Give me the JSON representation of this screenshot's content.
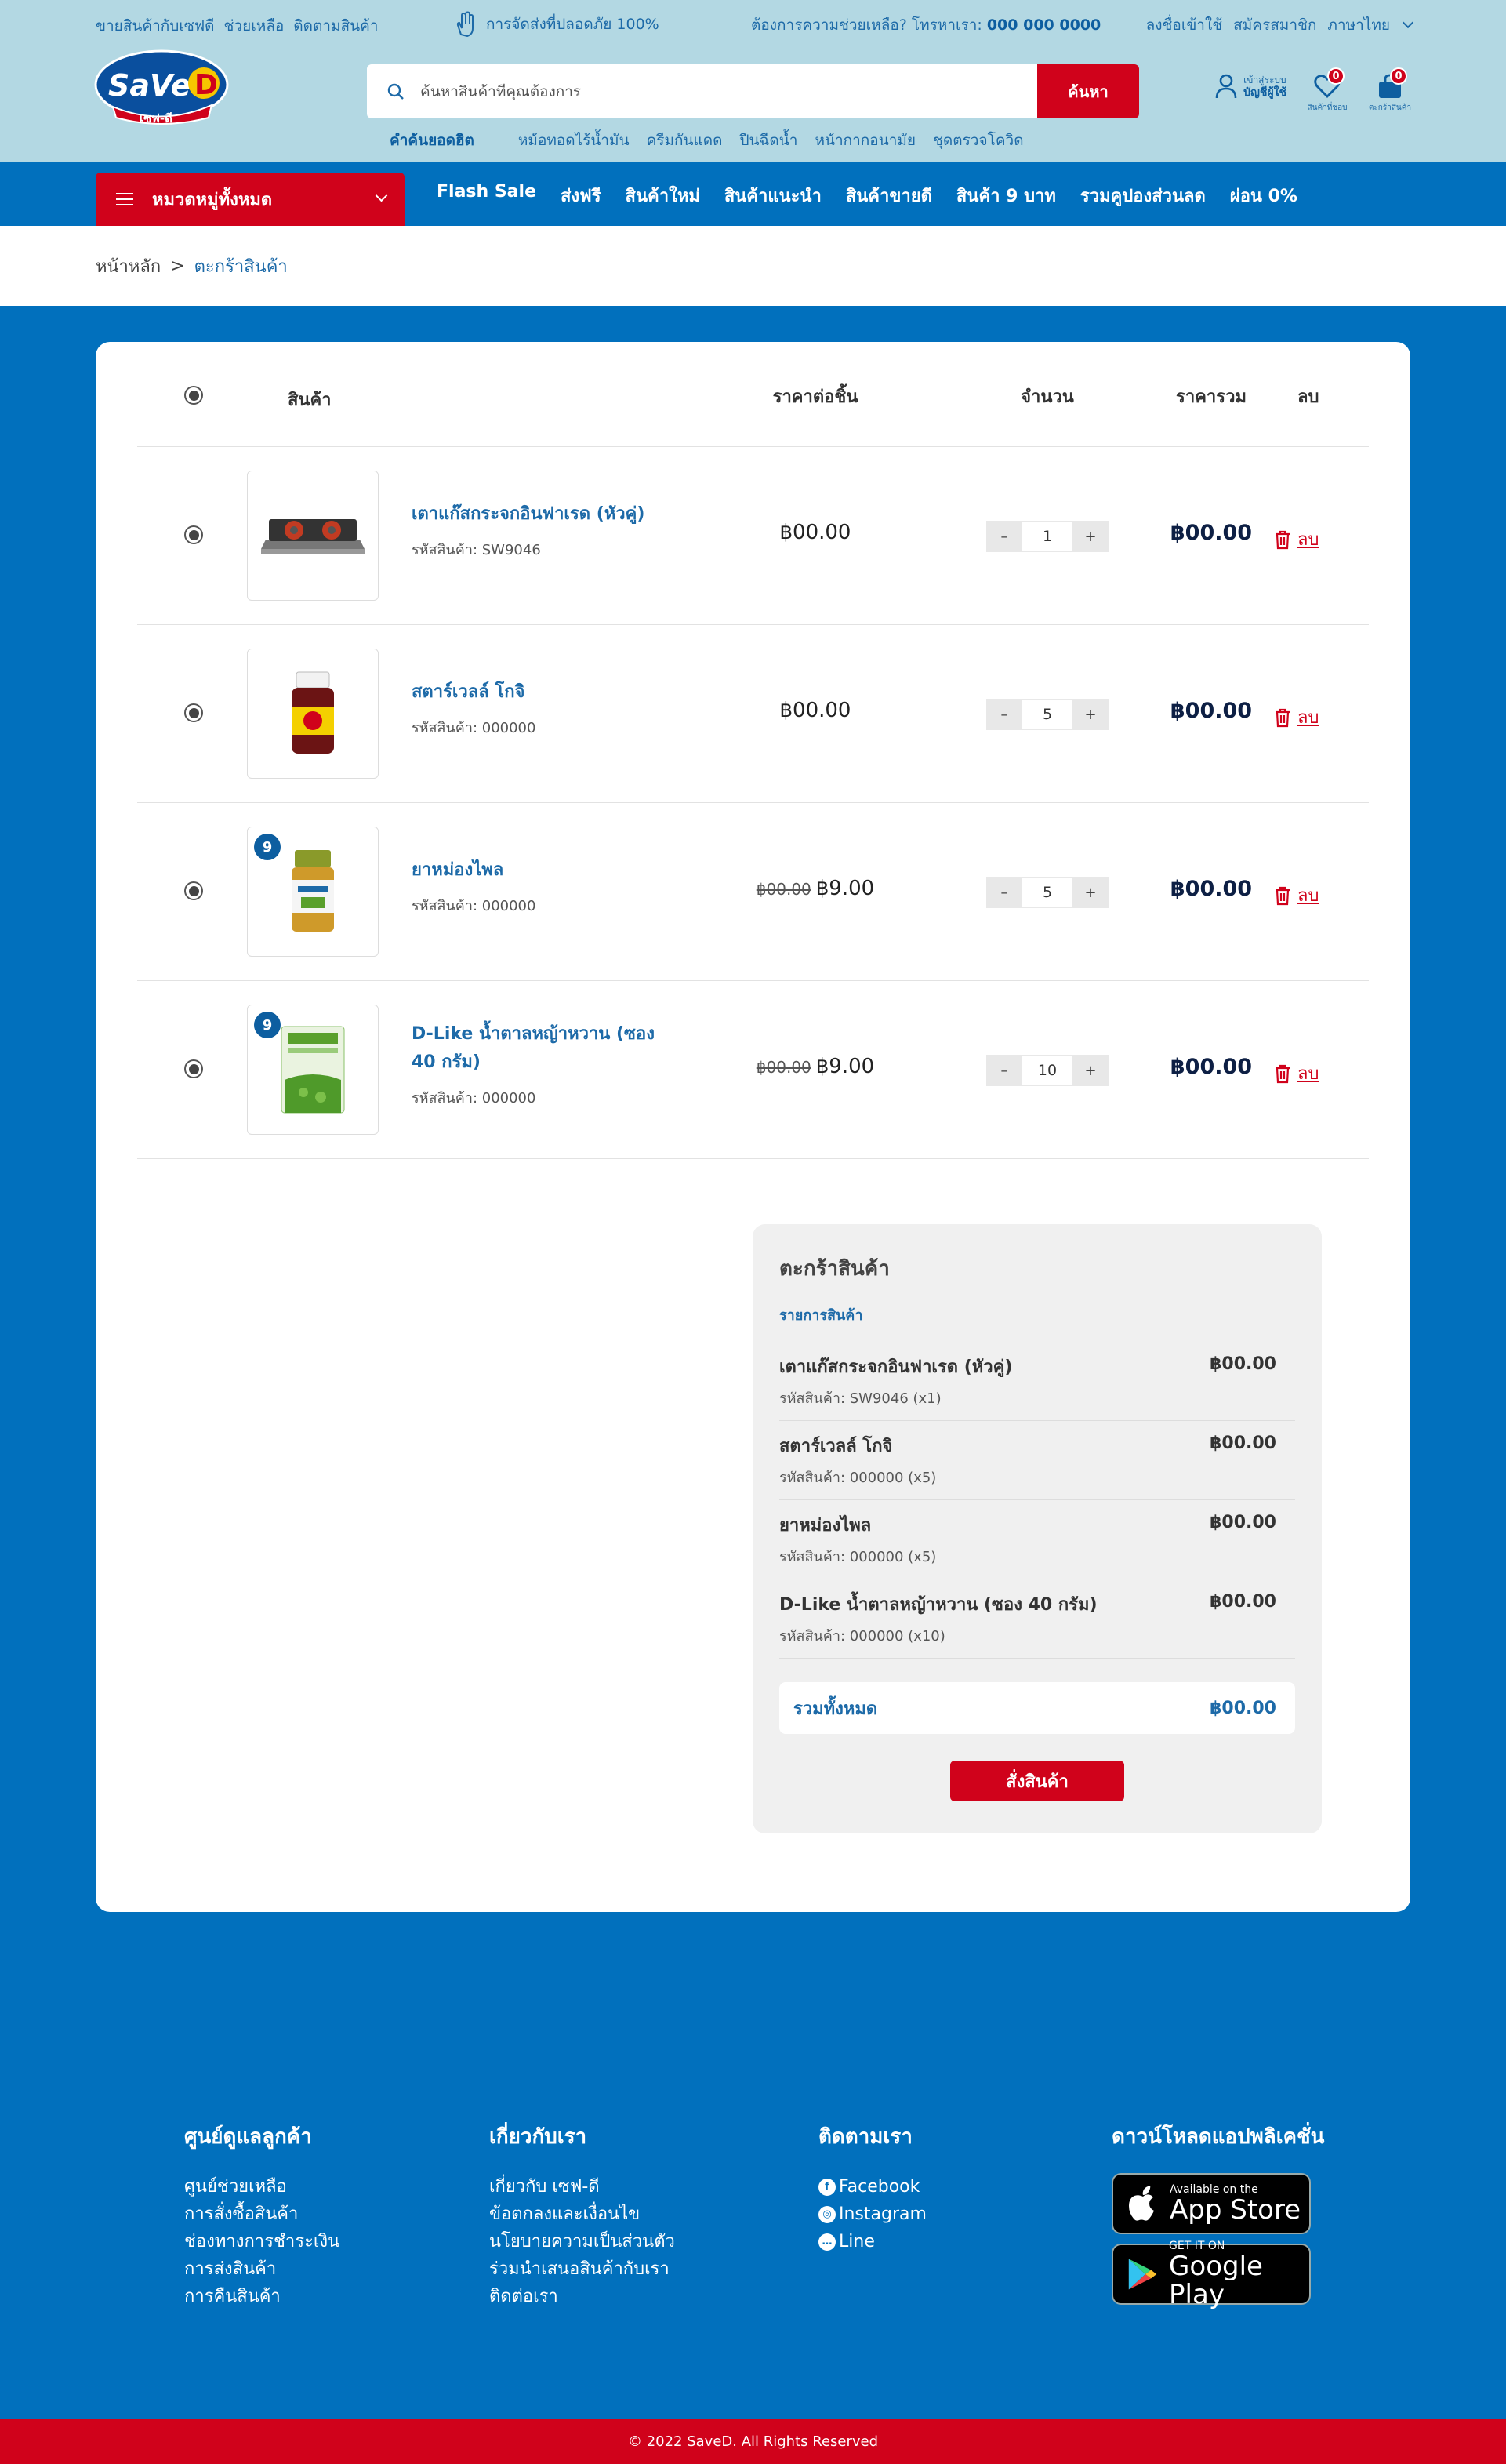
{
  "topbar": {
    "links": [
      "ขายสินค้ากับเซฟดี",
      "ช่วยเหลือ",
      "ติดตามสินค้า"
    ],
    "shipping": "การจัดส่งที่ปลอดภัย 100%",
    "help_prefix": "ต้องการความช่วยเหลือ? โทรหาเรา:",
    "help_phone": "000 000 0000",
    "login": "ลงชื่อเข้าใช้",
    "register": "สมัครสมาชิก",
    "language": "ภาษาไทย"
  },
  "logo": {
    "text": "SaVe-D",
    "sub": "เซฟ-ดี"
  },
  "search": {
    "placeholder": "ค้นหาสินค้าที่คุณต้องการ",
    "button": "ค้นหา"
  },
  "hot_search": {
    "label": "คำค้นยอดฮิต",
    "terms": [
      "หม้อทอดไร้น้ำมัน",
      "ครีมกันแดด",
      "ปืนฉีดน้ำ",
      "หน้ากากอนามัย",
      "ชุดตรวจโควิด"
    ]
  },
  "account": {
    "line1": "เข้าสู่ระบบ",
    "line2": "บัญชีผู้ใช้"
  },
  "wishlist": {
    "label": "สินค้าที่ชอบ",
    "count": "0"
  },
  "cart": {
    "label": "ตะกร้าสินค้า",
    "count": "0"
  },
  "nav": {
    "categories": "หมวดหมู่ทั้งหมด",
    "links": [
      "Flash Sale",
      "ส่งฟรี",
      "สินค้าใหม่",
      "สินค้าแนะนำ",
      "สินค้าขายดี",
      "สินค้า 9 บาท",
      "รวมคูปองส่วนลด",
      "ผ่อน 0%"
    ]
  },
  "breadcrumb": {
    "home": "หน้าหลัก",
    "sep": ">",
    "current": "ตะกร้าสินค้า"
  },
  "table": {
    "headers": {
      "product": "สินค้า",
      "unit_price": "ราคาต่อชิ้น",
      "qty": "จำนวน",
      "total": "ราคารวม",
      "delete": "ลบ"
    },
    "rows": [
      {
        "name": "เตาแก๊สกระจกอินฟาเรด (หัวคู่)",
        "code": "รหัสสินค้า: SW9046",
        "old_price": "",
        "price": "฿00.00",
        "qty": "1",
        "total": "฿00.00",
        "delete": "ลบ",
        "badge": ""
      },
      {
        "name": "สตาร์เวลล์ โกจิ",
        "code": "รหัสสินค้า: 000000",
        "old_price": "",
        "price": "฿00.00",
        "qty": "5",
        "total": "฿00.00",
        "delete": "ลบ",
        "badge": ""
      },
      {
        "name": "ยาหม่องไพล",
        "code": "รหัสสินค้า: 000000",
        "old_price": "฿00.00",
        "price": "฿9.00",
        "qty": "5",
        "total": "฿00.00",
        "delete": "ลบ",
        "badge": "9"
      },
      {
        "name": "D-Like น้ำตาลหญ้าหวาน (ซอง 40 กรัม)",
        "code": "รหัสสินค้า: 000000",
        "old_price": "฿00.00",
        "price": "฿9.00",
        "qty": "10",
        "total": "฿00.00",
        "delete": "ลบ",
        "badge": "9"
      }
    ]
  },
  "summary": {
    "title": "ตะกร้าสินค้า",
    "subtitle": "รายการสินค้า",
    "items": [
      {
        "name": "เตาแก๊สกระจกอินฟาเรด (หัวคู่)",
        "code": "รหัสสินค้า: SW9046 (x1)",
        "price": "฿00.00"
      },
      {
        "name": "สตาร์เวลล์ โกจิ",
        "code": "รหัสสินค้า: 000000 (x5)",
        "price": "฿00.00"
      },
      {
        "name": "ยาหม่องไพล",
        "code": "รหัสสินค้า: 000000 (x5)",
        "price": "฿00.00"
      },
      {
        "name": "D-Like น้ำตาลหญ้าหวาน (ซอง 40 กรัม)",
        "code": "รหัสสินค้า: 000000 (x10)",
        "price": "฿00.00"
      }
    ],
    "total_label": "รวมทั้งหมด",
    "total_value": "฿00.00",
    "order_button": "สั่งสินค้า"
  },
  "footer": {
    "customer": {
      "title": "ศูนย์ดูแลลูกค้า",
      "links": [
        "ศูนย์ช่วยเหลือ",
        "การสั่งซื้อสินค้า",
        "ช่องทางการชำระเงิน",
        "การส่งสินค้า",
        "การคืนสินค้า"
      ]
    },
    "about": {
      "title": "เกี่ยวกับเรา",
      "links": [
        "เกี่ยวกับ เซฟ-ดี",
        "ข้อตกลงและเงื่อนไข",
        "นโยบายความเป็นส่วนตัว",
        "ร่วมนำเสนอสินค้ากับเรา",
        "ติดต่อเรา"
      ]
    },
    "follow": {
      "title": "ติดตามเรา",
      "links": [
        "Facebook",
        "Instagram",
        "Line"
      ]
    },
    "app": {
      "title": "ดาวน์โหลดแอปพลิเคชั่น",
      "appstore_small": "Available on the",
      "appstore": "App Store",
      "gplay_small": "GET IT ON",
      "gplay": "Google Play"
    },
    "copyright": "© 2022 SaveD. All Rights Reserved"
  },
  "colors": {
    "primary_blue": "#0170bd",
    "header_bg": "#b3d8e3",
    "accent_red": "#d0021b",
    "link_blue": "#1d6aa8"
  }
}
